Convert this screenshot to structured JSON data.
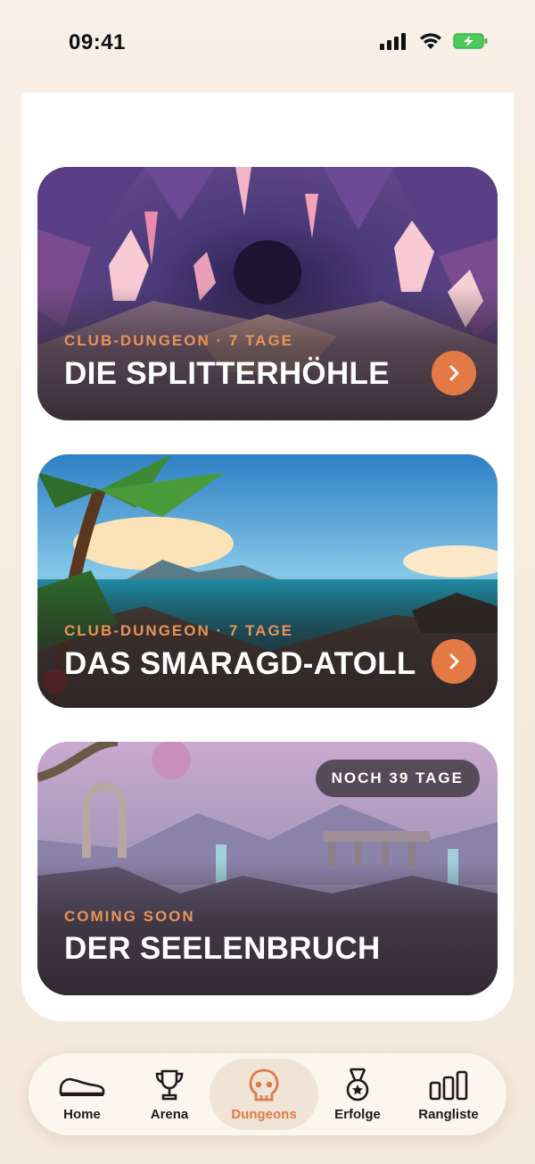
{
  "status_bar": {
    "time": "09:41",
    "signal_icon": "cellular-signal-icon",
    "wifi_icon": "wifi-icon",
    "battery_icon": "battery-charging-icon"
  },
  "dungeons": [
    {
      "subtitle": "CLUB-DUNGEON · 7 TAGE",
      "title": "DIE SPLITTERHÖHLE",
      "action_icon": "chevron-right-icon"
    },
    {
      "subtitle": "CLUB-DUNGEON · 7 TAGE",
      "title": "DAS SMARAGD-ATOLL",
      "action_icon": "chevron-right-icon"
    },
    {
      "subtitle": "COMING SOON",
      "title": "DER SEELENBRUCH",
      "badge": "NOCH 39 TAGE"
    }
  ],
  "tab_bar": {
    "items": [
      {
        "label": "Home",
        "icon": "shoe-icon"
      },
      {
        "label": "Arena",
        "icon": "trophy-icon"
      },
      {
        "label": "Dungeons",
        "icon": "skull-icon",
        "active": true
      },
      {
        "label": "Erfolge",
        "icon": "medal-icon"
      },
      {
        "label": "Rangliste",
        "icon": "bar-chart-icon"
      }
    ]
  },
  "colors": {
    "accent": "#e37a45",
    "subtitle": "#e8935a",
    "background": "#f6ece2",
    "card_panel": "#ffffff"
  }
}
